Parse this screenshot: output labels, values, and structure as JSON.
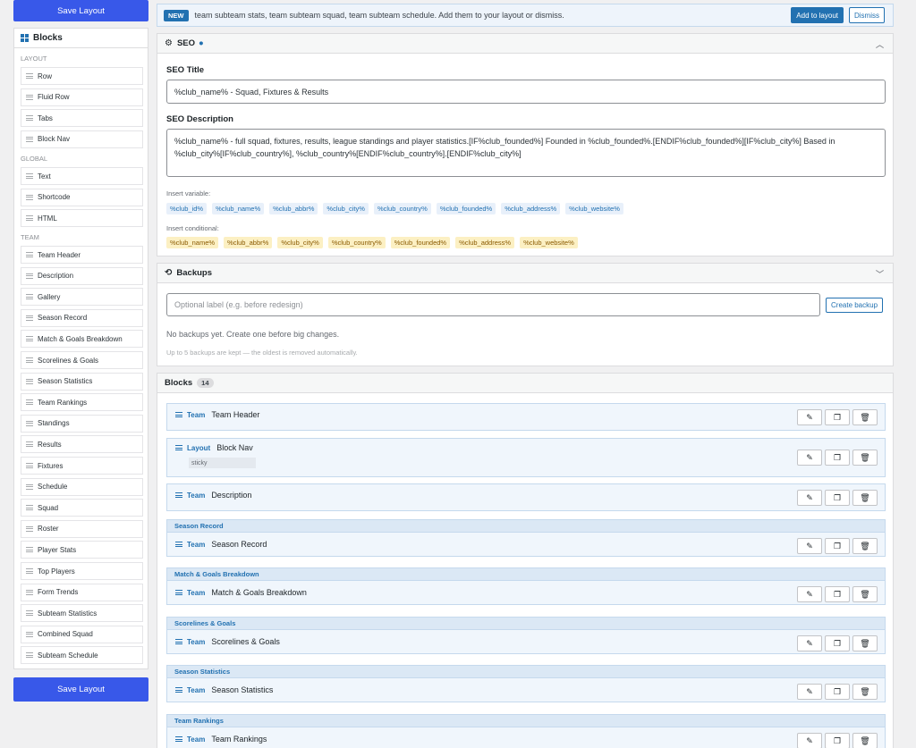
{
  "save_label": "Save Layout",
  "sidebar": {
    "title": "Blocks",
    "sections": [
      {
        "label": "LAYOUT",
        "items": [
          "Row",
          "Fluid Row",
          "Tabs",
          "Block Nav"
        ]
      },
      {
        "label": "GLOBAL",
        "items": [
          "Text",
          "Shortcode",
          "HTML"
        ]
      },
      {
        "label": "TEAM",
        "items": [
          "Team Header",
          "Description",
          "Gallery",
          "Season Record",
          "Match & Goals Breakdown",
          "Scorelines & Goals",
          "Season Statistics",
          "Team Rankings",
          "Standings",
          "Results",
          "Fixtures",
          "Schedule",
          "Squad",
          "Roster",
          "Player Stats",
          "Top Players",
          "Form Trends",
          "Subteam Statistics",
          "Combined Squad",
          "Subteam Schedule"
        ]
      }
    ]
  },
  "notice": {
    "badge": "NEW",
    "text": "team subteam stats, team subteam squad, team subteam schedule. Add them to your layout or dismiss.",
    "add_label": "Add to layout",
    "dismiss_label": "Dismiss"
  },
  "seo": {
    "title": "SEO",
    "title_label": "SEO Title",
    "title_value": "%club_name% - Squad, Fixtures & Results",
    "desc_label": "SEO Description",
    "desc_value": "%club_name% - full squad, fixtures, results, league standings and player statistics.[IF%club_founded%] Founded in %club_founded%.[ENDIF%club_founded%][IF%club_city%] Based in %club_city%[IF%club_country%], %club_country%[ENDIF%club_country%].[ENDIF%club_city%]",
    "insert_variable_label": "Insert variable:",
    "variables": [
      "%club_id%",
      "%club_name%",
      "%club_abbr%",
      "%club_city%",
      "%club_country%",
      "%club_founded%",
      "%club_address%",
      "%club_website%"
    ],
    "insert_conditional_label": "Insert conditional:",
    "conditionals": [
      "%club_name%",
      "%club_abbr%",
      "%club_city%",
      "%club_country%",
      "%club_founded%",
      "%club_address%",
      "%club_website%"
    ]
  },
  "backups": {
    "title": "Backups",
    "placeholder": "Optional label (e.g. before redesign)",
    "create_label": "Create backup",
    "empty_text": "No backups yet. Create one before big changes.",
    "note": "Up to 5 backups are kept — the oldest is removed automatically."
  },
  "blocks": {
    "title": "Blocks",
    "count": "14",
    "rows": [
      {
        "group": "",
        "cat": "Team",
        "name": "Team Header",
        "tag": ""
      },
      {
        "group": "",
        "cat": "Layout",
        "name": "Block Nav",
        "tag": "sticky"
      },
      {
        "group": "",
        "cat": "Team",
        "name": "Description",
        "tag": ""
      },
      {
        "group": "Season Record",
        "cat": "Team",
        "name": "Season Record",
        "tag": ""
      },
      {
        "group": "Match & Goals Breakdown",
        "cat": "Team",
        "name": "Match & Goals Breakdown",
        "tag": ""
      },
      {
        "group": "Scorelines & Goals",
        "cat": "Team",
        "name": "Scorelines & Goals",
        "tag": ""
      },
      {
        "group": "Season Statistics",
        "cat": "Team",
        "name": "Season Statistics",
        "tag": ""
      },
      {
        "group": "Team Rankings",
        "cat": "Team",
        "name": "Team Rankings",
        "tag": ""
      }
    ]
  },
  "icons": {
    "edit": "pencil-icon",
    "duplicate": "copy-icon",
    "delete": "trash-icon",
    "seo": "gear-icon",
    "backups": "history-icon"
  }
}
